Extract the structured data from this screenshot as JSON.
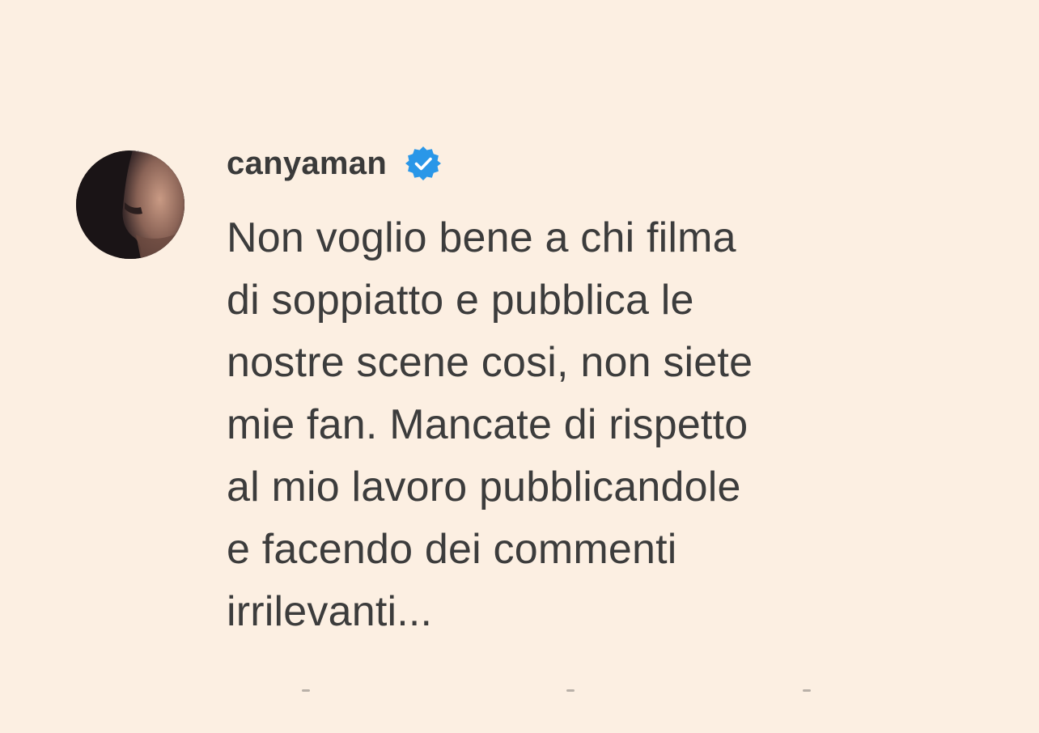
{
  "comment": {
    "username": "canyaman",
    "verified": true,
    "avatar_icon": "profile-photo",
    "verified_icon": "verified-badge-icon",
    "text": "Non voglio bene a chi filma\ndi soppiatto e pubblica le\nnostre scene cosi, non siete\nmie fan. Mancate di rispetto\nal mio lavoro pubblicandole\ne facendo dei commenti\nirrilevanti..."
  },
  "colors": {
    "background": "#fcefe2",
    "text": "#3c3c3c",
    "verified_badge": "#2a97e8"
  }
}
